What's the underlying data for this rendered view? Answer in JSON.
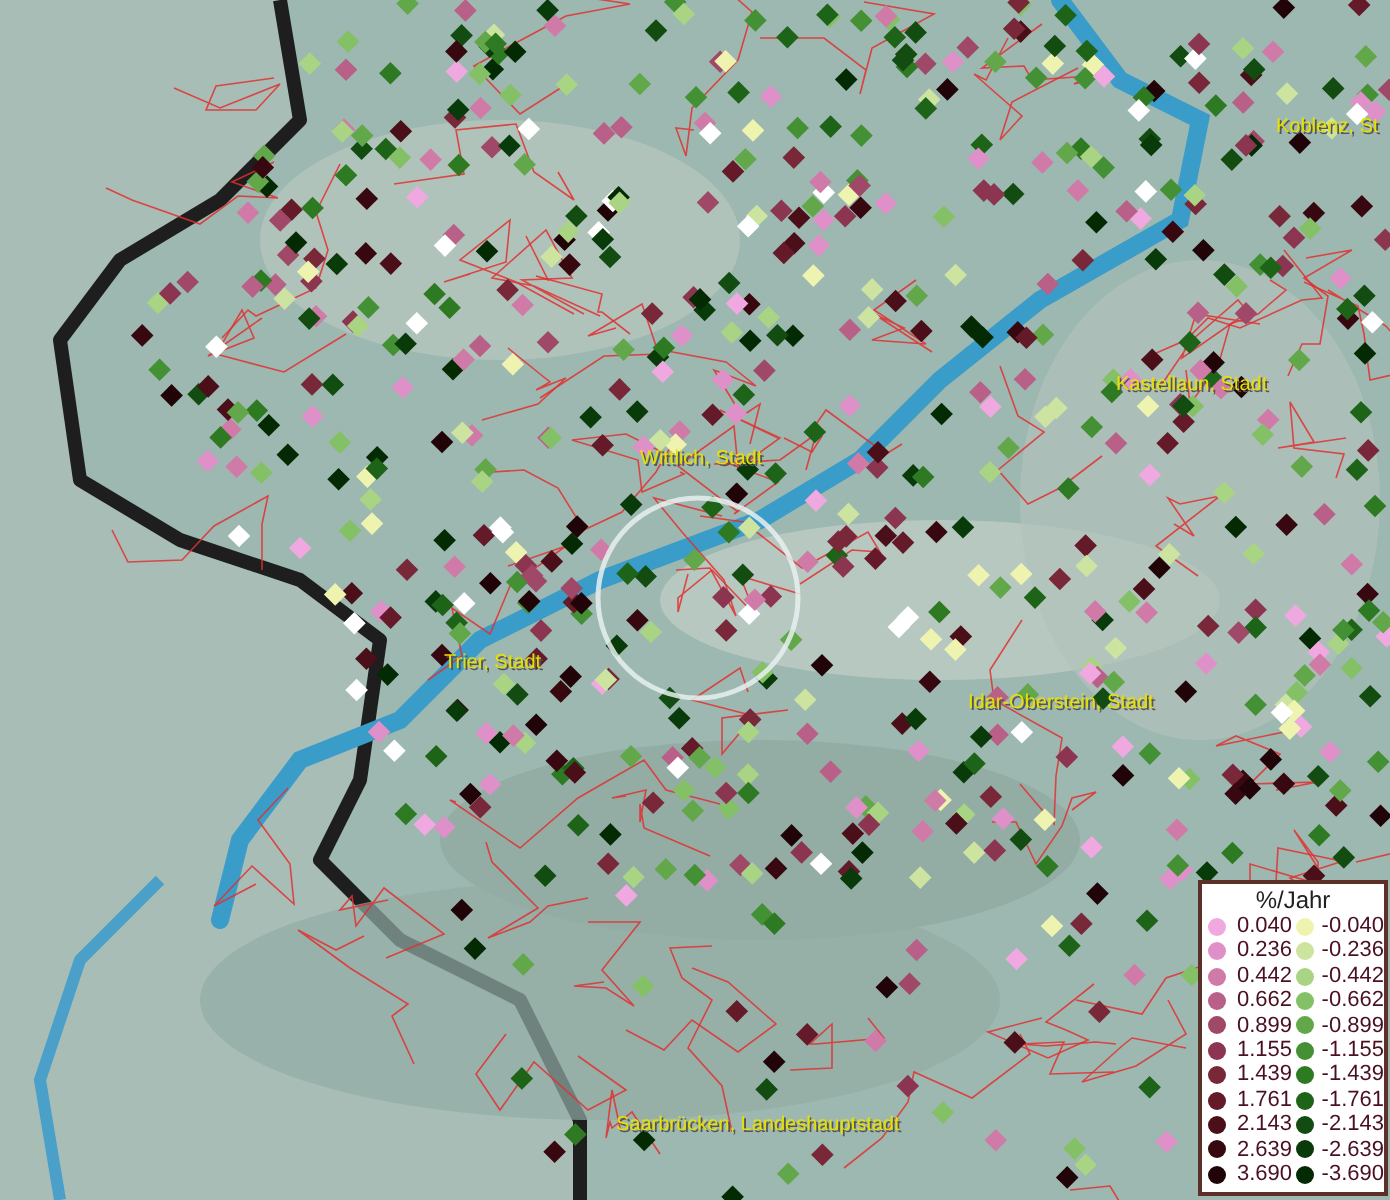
{
  "map": {
    "places": [
      {
        "kind": "city",
        "label": "Koblenz, St"
      },
      {
        "kind": "city",
        "label": "Kastellaun, Stadt"
      },
      {
        "kind": "city",
        "label": "Wittlich, Stadt"
      },
      {
        "kind": "city",
        "label": "Trier, Stadt"
      },
      {
        "kind": "city",
        "label": "Idar-Oberstein, Stadt"
      },
      {
        "kind": "city",
        "label": "Saarbrücken, Landeshauptstadt"
      }
    ]
  },
  "legend": {
    "title": "%/Jahr",
    "positive": [
      {
        "label": "0.040",
        "color": "#f0a8e0"
      },
      {
        "label": "0.236",
        "color": "#e090c8"
      },
      {
        "label": "0.442",
        "color": "#d07aa8"
      },
      {
        "label": "0.662",
        "color": "#b86088"
      },
      {
        "label": "0.899",
        "color": "#a04868"
      },
      {
        "label": "1.155",
        "color": "#8c3550"
      },
      {
        "label": "1.439",
        "color": "#782838"
      },
      {
        "label": "1.761",
        "color": "#641a28"
      },
      {
        "label": "2.143",
        "color": "#4a0f18"
      },
      {
        "label": "2.639",
        "color": "#380810"
      },
      {
        "label": "3.690",
        "color": "#200408"
      }
    ],
    "negative": [
      {
        "label": "-0.040",
        "color": "#eef4b0"
      },
      {
        "label": "-0.236",
        "color": "#cce4a0"
      },
      {
        "label": "-0.442",
        "color": "#a8d484"
      },
      {
        "label": "-0.662",
        "color": "#84c066"
      },
      {
        "label": "-0.899",
        "color": "#62a84a"
      },
      {
        "label": "-1.155",
        "color": "#449034"
      },
      {
        "label": "-1.439",
        "color": "#2e7a22"
      },
      {
        "label": "-1.761",
        "color": "#1e6418"
      },
      {
        "label": "-2.143",
        "color": "#124c10"
      },
      {
        "label": "-2.639",
        "color": "#093a09"
      },
      {
        "label": "-3.690",
        "color": "#042a04"
      }
    ]
  }
}
